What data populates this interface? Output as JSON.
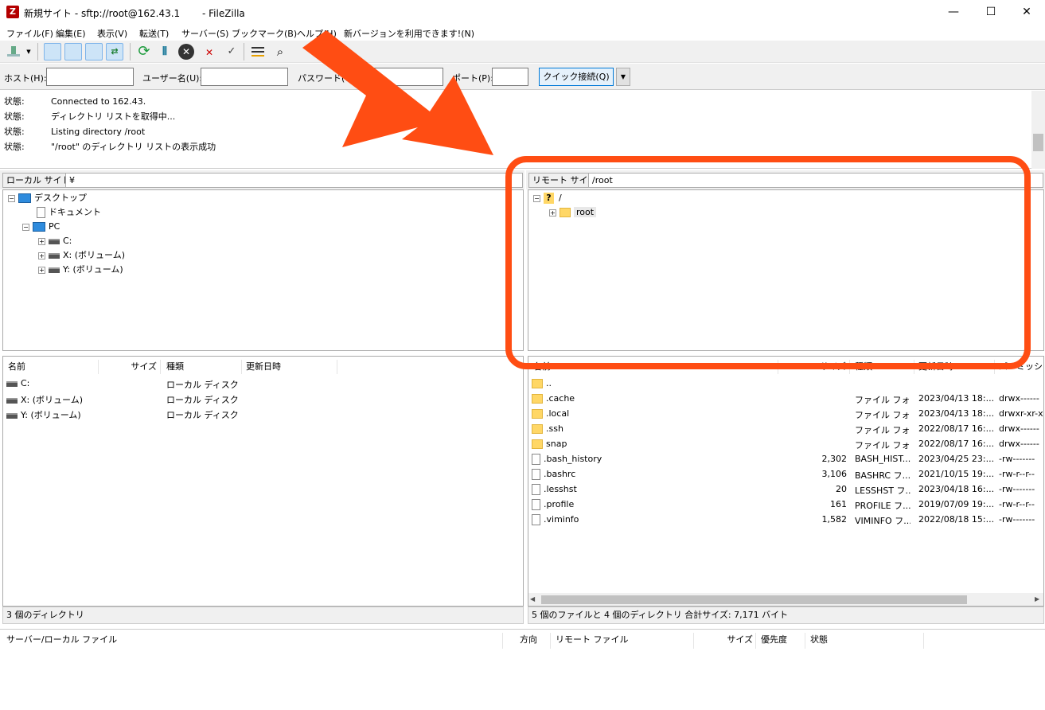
{
  "window": {
    "title": "新規サイト - sftp://root@162.43.1　　 - FileZilla",
    "logo": "Z",
    "controls": {
      "minimize": "—",
      "maximize": "☐",
      "close": "✕"
    }
  },
  "menu": [
    "ファイル(F)",
    "編集(E)",
    "表示(V)",
    "転送(T)",
    "サーバー(S)",
    "ブックマーク(B)",
    "ヘルプ(H)",
    "新バージョンを利用できます!(N)"
  ],
  "quickconnect": {
    "host_label": "ホスト(H):",
    "user_label": "ユーザー名(U):",
    "password_label": "パスワード(W):",
    "port_label": "ポート(P):",
    "host_value": "",
    "user_value": "",
    "password_value": "",
    "port_value": "",
    "connect_button": "クイック接続(Q)",
    "dropdown": "▼"
  },
  "log": [
    {
      "label": "状態:",
      "text": "Connected to 162.43."
    },
    {
      "label": "状態:",
      "text": "ディレクトリ リストを取得中..."
    },
    {
      "label": "状態:",
      "text": "Listing directory /root"
    },
    {
      "label": "状態:",
      "text": "\"/root\" のディレクトリ リストの表示成功"
    }
  ],
  "local": {
    "path_label": "ローカル サイト:",
    "path_value": "¥",
    "tree": [
      {
        "label": "デスクトップ",
        "icon": "desktop-icon"
      },
      {
        "label": "ドキュメント",
        "icon": "document-icon"
      },
      {
        "label": "PC",
        "icon": "pc-icon"
      },
      {
        "label": "C:",
        "icon": "drive-icon"
      },
      {
        "label": "X: (ボリューム)",
        "icon": "drive-icon"
      },
      {
        "label": "Y: (ボリューム)",
        "icon": "drive-icon"
      }
    ],
    "columns": {
      "name": "名前",
      "size": "サイズ",
      "type": "種類",
      "modified": "更新日時"
    },
    "files": [
      {
        "name": "C:",
        "type": "ローカル ディスク"
      },
      {
        "name": "X: (ボリューム)",
        "type": "ローカル ディスク"
      },
      {
        "name": "Y: (ボリューム)",
        "type": "ローカル ディスク"
      }
    ],
    "status": "3 個のディレクトリ"
  },
  "remote": {
    "path_label": "リモート サイト:",
    "path_value": "/root",
    "tree": [
      {
        "label": "/",
        "icon": "unknown-icon"
      },
      {
        "label": "root",
        "icon": "folder-icon"
      }
    ],
    "columns": {
      "name": "名前",
      "size": "サイズ",
      "type": "種類",
      "modified": "更新日時",
      "perm": "パーミッション"
    },
    "files": [
      {
        "name": "..",
        "size": "",
        "type": "",
        "modified": "",
        "perm": "",
        "icon": "folder"
      },
      {
        "name": ".cache",
        "size": "",
        "type": "ファイル フォ...",
        "modified": "2023/04/13 18:...",
        "perm": "drwx------",
        "icon": "folder"
      },
      {
        "name": ".local",
        "size": "",
        "type": "ファイル フォ...",
        "modified": "2023/04/13 18:...",
        "perm": "drwxr-xr-x",
        "icon": "folder"
      },
      {
        "name": ".ssh",
        "size": "",
        "type": "ファイル フォ...",
        "modified": "2022/08/17 16:...",
        "perm": "drwx------",
        "icon": "folder"
      },
      {
        "name": "snap",
        "size": "",
        "type": "ファイル フォ...",
        "modified": "2022/08/17 16:...",
        "perm": "drwx------",
        "icon": "folder"
      },
      {
        "name": ".bash_history",
        "size": "2,302",
        "type": "BASH_HIST...",
        "modified": "2023/04/25 23:...",
        "perm": "-rw-------",
        "icon": "file"
      },
      {
        "name": ".bashrc",
        "size": "3,106",
        "type": "BASHRC フ...",
        "modified": "2021/10/15 19:...",
        "perm": "-rw-r--r--",
        "icon": "file"
      },
      {
        "name": ".lesshst",
        "size": "20",
        "type": "LESSHST フ...",
        "modified": "2023/04/18 16:...",
        "perm": "-rw-------",
        "icon": "file"
      },
      {
        "name": ".profile",
        "size": "161",
        "type": "PROFILE フ...",
        "modified": "2019/07/09 19:...",
        "perm": "-rw-r--r--",
        "icon": "file"
      },
      {
        "name": ".viminfo",
        "size": "1,582",
        "type": "VIMINFO フ...",
        "modified": "2022/08/18 15:...",
        "perm": "-rw-------",
        "icon": "file"
      }
    ],
    "status": "5 個のファイルと 4 個のディレクトリ 合計サイズ: 7,171 バイト"
  },
  "queue": {
    "columns": [
      "サーバー/ローカル ファイル",
      "方向",
      "リモート ファイル",
      "サイズ",
      "優先度",
      "状態"
    ]
  },
  "colors": {
    "highlight": "#ff4d13",
    "accent": "#0078d7"
  }
}
